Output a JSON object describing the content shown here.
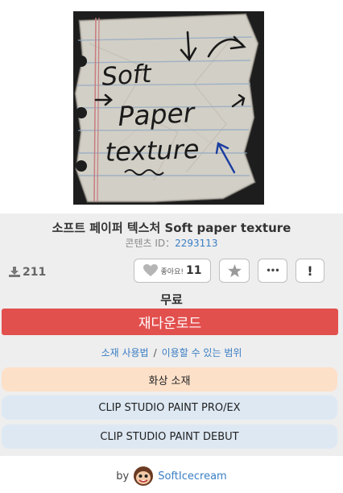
{
  "material": {
    "title": "소프트 페이퍼 텍스처 Soft paper texture",
    "content_id_label": "콘텐츠 ID：",
    "content_id": "2293113",
    "thumbnail_lines": [
      "Soft",
      "Paper",
      "texture"
    ]
  },
  "stats": {
    "downloads": "211"
  },
  "actions": {
    "like_label": "좋아요!",
    "like_count": "11",
    "more_label": "•••",
    "report_label": "!"
  },
  "price": "무료",
  "download_button": "재다운로드",
  "links": {
    "usage": "소재 사용법",
    "separator": "/",
    "scope": "이용할 수 있는 범위"
  },
  "tags": [
    "화상 소재",
    "CLIP STUDIO PAINT PRO/EX",
    "CLIP STUDIO PAINT DEBUT"
  ],
  "author": {
    "by": "by",
    "name": "SoftIcecream"
  },
  "colors": {
    "accent": "#e2504e",
    "link": "#3a7ec4",
    "tag_orange": "#fde0c8",
    "tag_blue": "#dde8f3"
  }
}
